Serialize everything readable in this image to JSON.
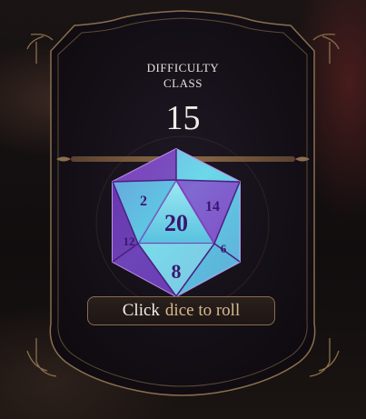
{
  "difficulty": {
    "label_line1": "DIFFICULTY",
    "label_line2": "CLASS",
    "value": "15"
  },
  "dice": {
    "icon": "d20-icon",
    "face_top": "20",
    "face_bottom": "8",
    "face_left": "2",
    "face_right": "14",
    "face_lower_left": "12",
    "face_lower_right": "6",
    "color_primary": "#7b3fb8",
    "color_glow": "#4fd6e8"
  },
  "roll_button": {
    "word1": "Click",
    "word2": "dice to roll"
  },
  "colors": {
    "frame": "#8a6e4e",
    "text": "#f0ebe5",
    "accent_text": "#d8b98f"
  }
}
